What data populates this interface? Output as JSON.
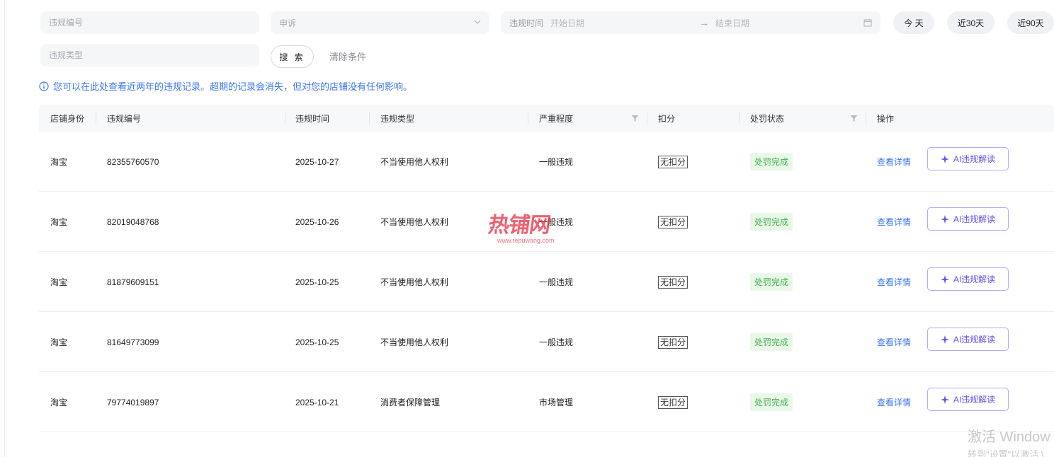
{
  "filters": {
    "violation_no_placeholder": "违规编号",
    "appeal_select_value": "申诉",
    "date_label": "违规时间",
    "date_start_placeholder": "开始日期",
    "date_arrow": "→",
    "date_end_placeholder": "结束日期",
    "violation_type_placeholder": "违规类型",
    "quick_today": "今 天",
    "quick_30": "近30天",
    "quick_90": "近90天",
    "search_label": "搜 索",
    "clear_label": "清除条件"
  },
  "notice": {
    "text": "您可以在此处查看近两年的违规记录。超期的记录会消失，但对您的店铺没有任何影响。",
    "color": "#3a74f0"
  },
  "table": {
    "headers": {
      "shop": "店铺身份",
      "no": "违规编号",
      "time": "违规时间",
      "type": "违规类型",
      "severity": "严重程度",
      "deduct": "扣分",
      "status": "处罚状态",
      "action": "操作"
    },
    "rows": [
      {
        "shop": "淘宝",
        "no": "82355760570",
        "time": "2025-10-27",
        "type": "不当使用他人权利",
        "severity": "一般违规",
        "deduct": "无扣分",
        "status": "处罚完成",
        "detail": "查看详情",
        "ai": "AI违规解读"
      },
      {
        "shop": "淘宝",
        "no": "82019048768",
        "time": "2025-10-26",
        "type": "不当使用他人权利",
        "severity": "一般违规",
        "deduct": "无扣分",
        "status": "处罚完成",
        "detail": "查看详情",
        "ai": "AI违规解读"
      },
      {
        "shop": "淘宝",
        "no": "81879609151",
        "time": "2025-10-25",
        "type": "不当使用他人权利",
        "severity": "一般违规",
        "deduct": "无扣分",
        "status": "处罚完成",
        "detail": "查看详情",
        "ai": "AI违规解读"
      },
      {
        "shop": "淘宝",
        "no": "81649773099",
        "time": "2025-10-25",
        "type": "不当使用他人权利",
        "severity": "一般违规",
        "deduct": "无扣分",
        "status": "处罚完成",
        "detail": "查看详情",
        "ai": "AI违规解读"
      },
      {
        "shop": "淘宝",
        "no": "79774019897",
        "time": "2025-10-21",
        "type": "消费者保障管理",
        "severity": "市场管理",
        "deduct": "无扣分",
        "status": "处罚完成",
        "detail": "查看详情",
        "ai": "AI违规解读"
      }
    ]
  },
  "watermark": {
    "logo_text": "热铺网",
    "url": "www.repuwang.com"
  },
  "windows_activation": {
    "line1": "激活 Window",
    "line2": "转到\"设置\"以激活 \\"
  },
  "icons": {
    "info": "info-circle-icon",
    "chevron": "chevron-down-icon",
    "calendar": "calendar-icon",
    "filter": "filter-funnel-icon",
    "ai_star": "sparkle-star-icon"
  },
  "colors": {
    "accent_blue": "#3a74f0",
    "status_green": "#41b34a",
    "status_green_bg": "#eaf8ea",
    "ai_purple": "#6552e8"
  }
}
